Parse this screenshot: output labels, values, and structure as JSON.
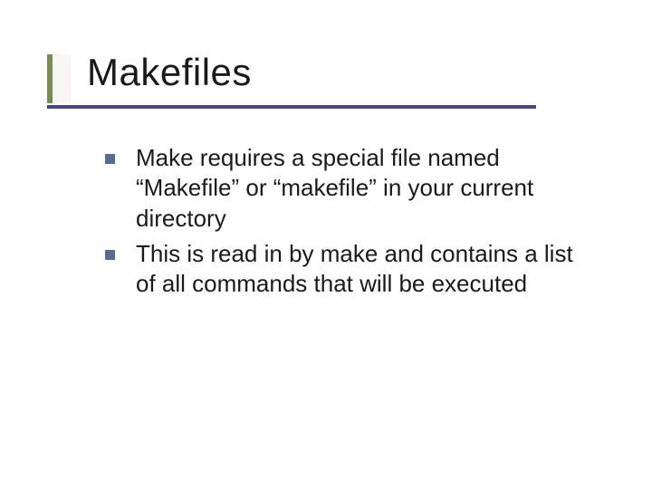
{
  "slide": {
    "title": "Makefiles",
    "bullets": [
      "Make requires a special file named “Makefile” or “makefile” in your current directory",
      "This is read in by make and contains a list of all commands that will be executed"
    ]
  }
}
